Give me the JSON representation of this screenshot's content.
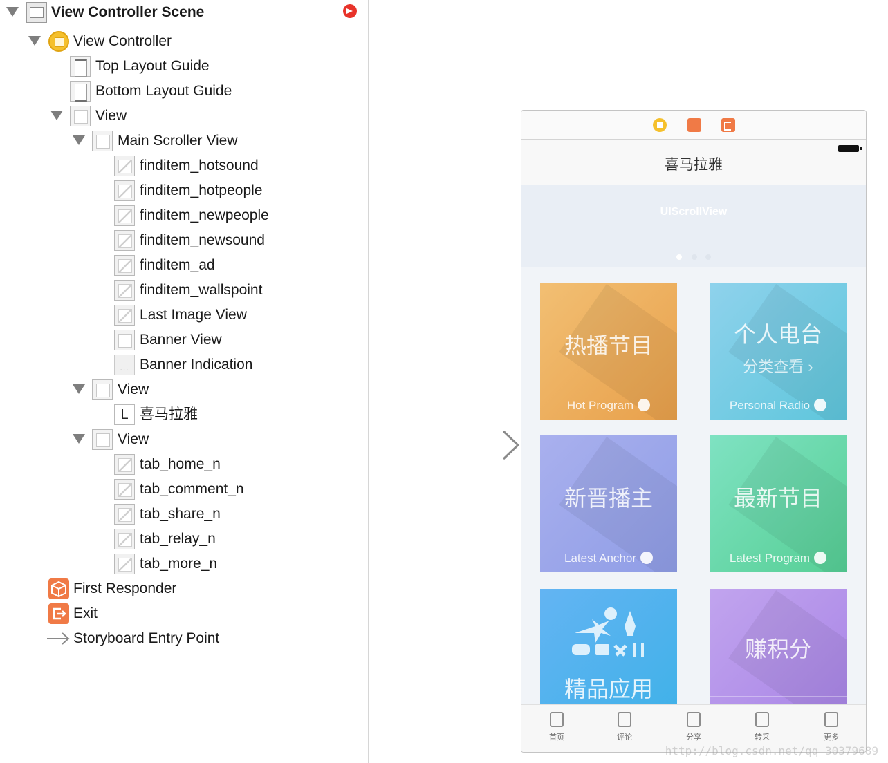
{
  "outline": {
    "scene_title": "View Controller Scene",
    "items": [
      {
        "label": "View Controller",
        "icon": "view-controller-icon"
      },
      {
        "label": "Top Layout Guide",
        "icon": "layout-guide-icon"
      },
      {
        "label": "Bottom Layout Guide",
        "icon": "layout-guide-icon"
      },
      {
        "label": "View",
        "icon": "view-icon"
      },
      {
        "label": "Main Scroller View",
        "icon": "scroll-view-icon"
      },
      {
        "label": "finditem_hotsound",
        "icon": "image-view-icon"
      },
      {
        "label": "finditem_hotpeople",
        "icon": "image-view-icon"
      },
      {
        "label": "finditem_newpeople",
        "icon": "image-view-icon"
      },
      {
        "label": "finditem_newsound",
        "icon": "image-view-icon"
      },
      {
        "label": "finditem_ad",
        "icon": "image-view-icon"
      },
      {
        "label": "finditem_wallspoint",
        "icon": "image-view-icon"
      },
      {
        "label": "Last Image View",
        "icon": "image-view-icon"
      },
      {
        "label": "Banner View",
        "icon": "view-icon"
      },
      {
        "label": "Banner Indication",
        "icon": "page-control-icon"
      },
      {
        "label": "View",
        "icon": "view-icon"
      },
      {
        "label": "喜马拉雅",
        "icon": "label-icon",
        "icon_text": "L"
      },
      {
        "label": "View",
        "icon": "view-icon"
      },
      {
        "label": "tab_home_n",
        "icon": "image-view-icon"
      },
      {
        "label": "tab_comment_n",
        "icon": "image-view-icon"
      },
      {
        "label": "tab_share_n",
        "icon": "image-view-icon"
      },
      {
        "label": "tab_relay_n",
        "icon": "image-view-icon"
      },
      {
        "label": "tab_more_n",
        "icon": "image-view-icon"
      },
      {
        "label": "First Responder",
        "icon": "first-responder-icon"
      },
      {
        "label": "Exit",
        "icon": "exit-icon"
      },
      {
        "label": "Storyboard Entry Point",
        "icon": "entry-arrow-icon"
      }
    ]
  },
  "device": {
    "nav_title": "喜马拉雅",
    "banner_label": "UIScrollView",
    "tiles": [
      {
        "title": "热播节目",
        "english": "Hot Program",
        "icon": "flame-icon"
      },
      {
        "title": "个人电台",
        "subtitle": "分类查看 ›",
        "english": "Personal Radio",
        "icon": "radio-antenna-icon"
      },
      {
        "title": "新晋播主",
        "english": "Latest Anchor",
        "icon": "rocket-icon"
      },
      {
        "title": "最新节目",
        "english": "Latest Program",
        "icon": "sprout-icon"
      },
      {
        "title": "精品应用",
        "icon": "apps-collage-icon"
      },
      {
        "title": "赚积分"
      }
    ],
    "tabs": [
      {
        "label": "首页",
        "icon": "home-icon"
      },
      {
        "label": "评论",
        "icon": "comment-icon"
      },
      {
        "label": "分享",
        "icon": "share-icon"
      },
      {
        "label": "转采",
        "icon": "relay-icon"
      },
      {
        "label": "更多",
        "icon": "more-icon"
      }
    ]
  },
  "watermark": "http://blog.csdn.net/qq_30379689",
  "colors": {
    "hot": "#e8a04b",
    "radio": "#5ec6dc",
    "anchor": "#8f9de6",
    "latest": "#56cf95",
    "apps": "#3fb1e8",
    "points": "#a884e6",
    "accent_orange": "#f07a46",
    "vc_yellow": "#f5c02c"
  }
}
